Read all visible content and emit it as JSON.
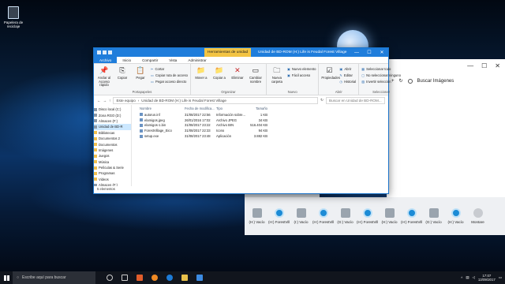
{
  "desktop": {
    "recycle_bin_label": "Papelera de reciclaje"
  },
  "window": {
    "context_tab": "Herramientas de unidad",
    "title": "Unidad de BD-ROM (H:) Life is Feudal Forest Village",
    "controls": [
      "—",
      "☐",
      "✕"
    ],
    "tabs": [
      "Archivo",
      "Inicio",
      "Compartir",
      "Vista",
      "Administrar"
    ]
  },
  "ribbon": {
    "portapapeles": {
      "caption": "Portapapeles",
      "anclar": "Anclar al Acceso rápido",
      "copiar": "Copiar",
      "pegar": "Pegar",
      "cortar": "Cortar",
      "copiar_ruta": "Copiar ruta de acceso",
      "pegar_acceso": "Pegar acceso directo"
    },
    "organizar": {
      "caption": "Organizar",
      "mover": "Mover a",
      "copiar_a": "Copiar a",
      "eliminar": "Eliminar",
      "cambiar_nombre": "Cambiar nombre"
    },
    "nuevo": {
      "caption": "Nuevo",
      "nueva_carpeta": "Nueva carpeta",
      "nuevo_elemento": "Nuevo elemento",
      "facil_acceso": "Fácil acceso"
    },
    "abrir": {
      "caption": "Abrir",
      "propiedades": "Propiedades",
      "abrir": "Abrir",
      "editar": "Editar",
      "historial": "Historial"
    },
    "seleccionar": {
      "caption": "Seleccionar",
      "todo": "Seleccionar todo",
      "ninguno": "No seleccionar ninguno",
      "invertir": "Invertir selección"
    }
  },
  "address": {
    "crumbs": [
      "Este equipo",
      "Unidad de BD-ROM (H:) Life is Feudal Forest Village"
    ],
    "search_placeholder": "Buscar en Unidad de BD-ROM..."
  },
  "nav": [
    {
      "label": "Disco local (C:)",
      "type": "drive"
    },
    {
      "label": "Zona RGO (D:)",
      "type": "drive"
    },
    {
      "label": "Almacen (F:)",
      "type": "drive"
    },
    {
      "label": "Unidad de BD-R",
      "type": "drive",
      "selected": true
    },
    {
      "label": "Bibliotecas",
      "type": "folder"
    },
    {
      "label": "Documentos 2",
      "type": "folder"
    },
    {
      "label": "Documentos",
      "type": "folder"
    },
    {
      "label": "Imágenes",
      "type": "folder"
    },
    {
      "label": "Juegos",
      "type": "folder"
    },
    {
      "label": "Música",
      "type": "folder"
    },
    {
      "label": "Películas & Serie",
      "type": "folder"
    },
    {
      "label": "Programas",
      "type": "folder"
    },
    {
      "label": "Videos",
      "type": "folder"
    },
    {
      "label": "Almacen (F:)",
      "type": "drive"
    }
  ],
  "files": {
    "headers": [
      "Nombre",
      "Fecha de modifica...",
      "Tipo",
      "Tamaño"
    ],
    "rows": [
      {
        "name": "autorun.inf",
        "date": "31/08/2017 22:56",
        "type": "Información sobre...",
        "size": "1 KB"
      },
      {
        "name": "elamigos.jpeg",
        "date": "26/01/2016 17:02",
        "type": "Archivo JPEG",
        "size": "34 KB"
      },
      {
        "name": "elamigos-1.bin",
        "date": "31/08/2017 23:22",
        "type": "Archivo BIN",
        "size": "516.404 KB"
      },
      {
        "name": "ForestVillage_Eico",
        "date": "31/08/2017 22:33",
        "type": "Icono",
        "size": "94 KB"
      },
      {
        "name": "setup.exe",
        "date": "31/08/2017 23:48",
        "type": "Aplicación",
        "size": "3.882 KB"
      }
    ]
  },
  "status_text": "5 elementos",
  "background_window": {
    "search_label": "Buscar Imágenes"
  },
  "strip_tiles": [
    "(H:) Vacío",
    "(H:) ForestVill...",
    "(I:) Vacío",
    "(H:) ForestVill...",
    "(G:) Vacío",
    "(H:) ForestVill...",
    "(H:) Vacío",
    "(H:) ForestVill...",
    "(G:) Vacío",
    "(H:) Vacío",
    "Montare"
  ],
  "taskbar": {
    "search_placeholder": "Escribe aquí para buscar",
    "time": "17:07",
    "date": "13/09/2017"
  }
}
